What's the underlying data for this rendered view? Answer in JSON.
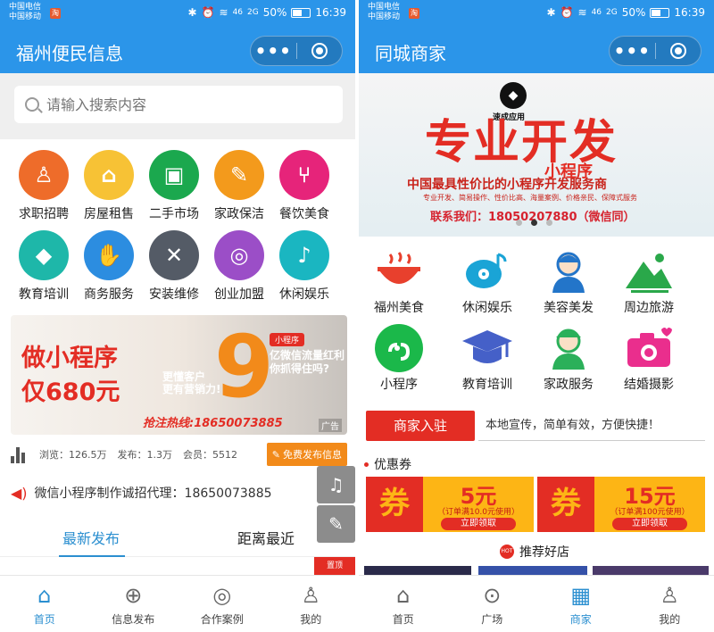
{
  "status": {
    "carrier1": "中国电信",
    "carrier2": "中国移动",
    "signal": "46",
    "signal2": "2G",
    "battery": "50%",
    "time": "16:39"
  },
  "left": {
    "nav_title": "福州便民信息",
    "search_placeholder": "请输入搜索内容",
    "categories": [
      {
        "label": "求职招聘",
        "color": "#ee6c2a",
        "glyph": "♙",
        "icon": "job-icon"
      },
      {
        "label": "房屋租售",
        "color": "#f7c235",
        "glyph": "⌂",
        "icon": "house-icon"
      },
      {
        "label": "二手市场",
        "color": "#1ba84e",
        "glyph": "▣",
        "icon": "box-icon"
      },
      {
        "label": "家政保洁",
        "color": "#f39a1c",
        "glyph": "✎",
        "icon": "broom-icon"
      },
      {
        "label": "餐饮美食",
        "color": "#e6247a",
        "glyph": "⑂",
        "icon": "fork-knife-icon"
      },
      {
        "label": "教育培训",
        "color": "#1eb7a9",
        "glyph": "◆",
        "icon": "graduation-cap-icon"
      },
      {
        "label": "商务服务",
        "color": "#2c8de0",
        "glyph": "✋",
        "icon": "handshake-icon"
      },
      {
        "label": "安装维修",
        "color": "#545b66",
        "glyph": "✕",
        "icon": "tools-icon"
      },
      {
        "label": "创业加盟",
        "color": "#9b4ec7",
        "glyph": "◎",
        "icon": "bulb-icon"
      },
      {
        "label": "休闲娱乐",
        "color": "#1ab6c1",
        "glyph": "♪",
        "icon": "music-icon"
      }
    ],
    "banner": {
      "line1": "做小程序",
      "line2": "仅680元",
      "number": "9",
      "tag": "小程序",
      "right1": "亿微信流量红利",
      "right2": "你抓得住吗?",
      "mid1": "更懂客户",
      "mid2": "更有营销力!",
      "hotline": "抢注热线:18650073885",
      "ad": "广告"
    },
    "stats": {
      "views": "浏览：126.5万",
      "posts": "发布：1.3万",
      "members": "会员：5512",
      "free_post": "免费发布信息"
    },
    "notice": "微信小程序制作诚招代理：18650073885",
    "tabs": {
      "latest": "最新发布",
      "nearest": "距离最近"
    },
    "ribbon": "置顶",
    "tabbar": [
      {
        "label": "首页",
        "icon": "home-icon",
        "glyph": "⌂"
      },
      {
        "label": "信息发布",
        "icon": "plus-circle-icon",
        "glyph": "⊕"
      },
      {
        "label": "合作案例",
        "icon": "handshake-circle-icon",
        "glyph": "◎"
      },
      {
        "label": "我的",
        "icon": "user-icon",
        "glyph": "♙"
      }
    ]
  },
  "right": {
    "nav_title": "同城商家",
    "banner": {
      "logo_text": "速成应用",
      "big": "专业开发",
      "sub": "小程序",
      "line1": "中国最具性价比的小程序开发服务商",
      "line2": "专业开发、简易操作、性价比高、海量案例、价格亲民、保障式服务",
      "line3": "联系我们：18050207880（微信同）"
    },
    "categories": [
      {
        "label": "福州美食",
        "icon": "hot-bowl-icon"
      },
      {
        "label": "休闲娱乐",
        "icon": "music-disc-icon"
      },
      {
        "label": "美容美发",
        "icon": "beauty-icon"
      },
      {
        "label": "周边旅游",
        "icon": "mountain-icon"
      },
      {
        "label": "小程序",
        "icon": "mini-program-icon"
      },
      {
        "label": "教育培训",
        "icon": "graduation-cap-icon"
      },
      {
        "label": "家政服务",
        "icon": "housekeeper-icon"
      },
      {
        "label": "结婚摄影",
        "icon": "camera-heart-icon"
      }
    ],
    "merchant_button": "商家入驻",
    "merchant_text": "本地宣传，简单有效，方便快捷！",
    "coupon_title": "优惠券",
    "coupons": [
      {
        "quan": "券",
        "amount": "5元",
        "condition": "（订单满10.0元使用）",
        "get": "立即领取"
      },
      {
        "quan": "券",
        "amount": "15元",
        "condition": "（订单满100元使用）",
        "get": "立即领取"
      }
    ],
    "recommend_title": "推荐好店",
    "hot_badge": "HOT",
    "tabbar": [
      {
        "label": "首页",
        "icon": "home-icon",
        "glyph": "⌂"
      },
      {
        "label": "广场",
        "icon": "location-pin-icon",
        "glyph": "⊙"
      },
      {
        "label": "商家",
        "icon": "shop-icon",
        "glyph": "▦"
      },
      {
        "label": "我的",
        "icon": "user-icon",
        "glyph": "♙"
      }
    ]
  },
  "colors": {
    "primary": "#2b95e9",
    "active_tab": "#2b8fd0",
    "accent_red": "#e32d24",
    "accent_orange": "#f28a1a",
    "coupon_yellow": "#fdb515"
  }
}
